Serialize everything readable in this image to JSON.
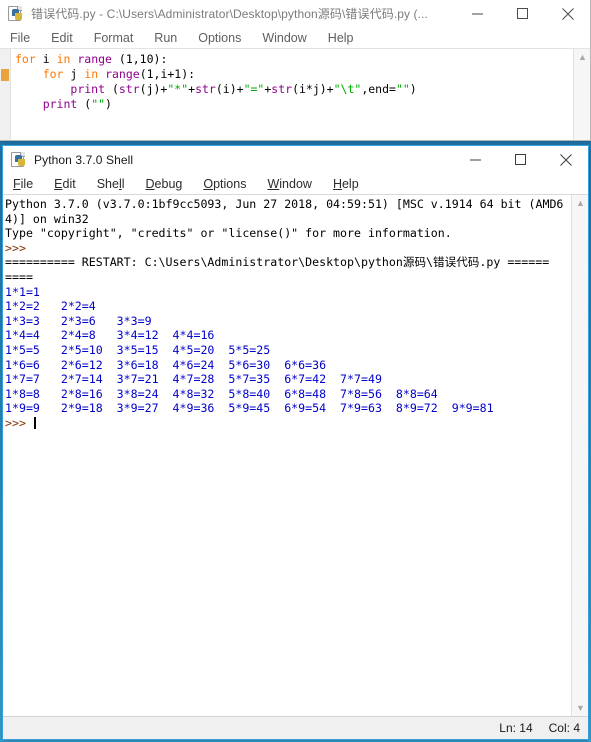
{
  "editor_window": {
    "title": "错误代码.py - C:\\Users\\Administrator\\Desktop\\python源码\\错误代码.py (...",
    "icon": "python-file-icon",
    "controls": {
      "minimize": "minimize-icon",
      "maximize": "maximize-icon",
      "close": "close-icon"
    },
    "menu": [
      "File",
      "Edit",
      "Format",
      "Run",
      "Options",
      "Window",
      "Help"
    ],
    "code_lines": [
      [
        {
          "t": "for",
          "c": "orange"
        },
        {
          "t": " i ",
          "c": "black"
        },
        {
          "t": "in",
          "c": "orange"
        },
        {
          "t": " ",
          "c": "black"
        },
        {
          "t": "range",
          "c": "purple"
        },
        {
          "t": " (1,10):",
          "c": "black"
        }
      ],
      [
        {
          "t": "    ",
          "c": "black"
        },
        {
          "t": "for",
          "c": "orange"
        },
        {
          "t": " j ",
          "c": "black"
        },
        {
          "t": "in",
          "c": "orange"
        },
        {
          "t": " ",
          "c": "black"
        },
        {
          "t": "range",
          "c": "purple"
        },
        {
          "t": "(1,i+1):",
          "c": "black"
        }
      ],
      [
        {
          "t": "        ",
          "c": "black"
        },
        {
          "t": "print",
          "c": "purple"
        },
        {
          "t": " (",
          "c": "black"
        },
        {
          "t": "str",
          "c": "purple"
        },
        {
          "t": "(j)+",
          "c": "black"
        },
        {
          "t": "\"*\"",
          "c": "green"
        },
        {
          "t": "+",
          "c": "black"
        },
        {
          "t": "str",
          "c": "purple"
        },
        {
          "t": "(i)+",
          "c": "black"
        },
        {
          "t": "\"=\"",
          "c": "green"
        },
        {
          "t": "+",
          "c": "black"
        },
        {
          "t": "str",
          "c": "purple"
        },
        {
          "t": "(i*j)+",
          "c": "black"
        },
        {
          "t": "\"\\t\"",
          "c": "green"
        },
        {
          "t": ",end=",
          "c": "black"
        },
        {
          "t": "\"\"",
          "c": "green"
        },
        {
          "t": ")",
          "c": "black"
        }
      ],
      [
        {
          "t": "    ",
          "c": "black"
        },
        {
          "t": "print",
          "c": "purple"
        },
        {
          "t": " (",
          "c": "black"
        },
        {
          "t": "\"\"",
          "c": "green"
        },
        {
          "t": ")",
          "c": "black"
        }
      ]
    ]
  },
  "shell_window": {
    "title": "Python 3.7.0 Shell",
    "icon": "python-shell-icon",
    "controls": {
      "minimize": "minimize-icon",
      "maximize": "maximize-icon",
      "close": "close-icon"
    },
    "menu": [
      {
        "label": "File",
        "accel": "F"
      },
      {
        "label": "Edit",
        "accel": "E"
      },
      {
        "label": "Shell",
        "accel": "l"
      },
      {
        "label": "Debug",
        "accel": "D"
      },
      {
        "label": "Options",
        "accel": "O"
      },
      {
        "label": "Window",
        "accel": "W"
      },
      {
        "label": "Help",
        "accel": "H"
      }
    ],
    "output_lines": [
      {
        "t": "Python 3.7.0 (v3.7.0:1bf9cc5093, Jun 27 2018, 04:59:51) [MSC v.1914 64 bit (AMD6",
        "c": "black"
      },
      {
        "t": "4)] on win32",
        "c": "black"
      },
      {
        "t": "Type \"copyright\", \"credits\" or \"license()\" for more information.",
        "c": "black"
      },
      {
        "t": ">>> ",
        "c": "brown"
      },
      {
        "t": "========== RESTART: C:\\Users\\Administrator\\Desktop\\python源码\\错误代码.py ======",
        "c": "black"
      },
      {
        "t": "====",
        "c": "black"
      },
      {
        "t": "1*1=1",
        "c": "blue"
      },
      {
        "t": "1*2=2   2*2=4",
        "c": "blue"
      },
      {
        "t": "1*3=3   2*3=6   3*3=9",
        "c": "blue"
      },
      {
        "t": "1*4=4   2*4=8   3*4=12  4*4=16",
        "c": "blue"
      },
      {
        "t": "1*5=5   2*5=10  3*5=15  4*5=20  5*5=25",
        "c": "blue"
      },
      {
        "t": "1*6=6   2*6=12  3*6=18  4*6=24  5*6=30  6*6=36",
        "c": "blue"
      },
      {
        "t": "1*7=7   2*7=14  3*7=21  4*7=28  5*7=35  6*7=42  7*7=49",
        "c": "blue"
      },
      {
        "t": "1*8=8   2*8=16  3*8=24  4*8=32  5*8=40  6*8=48  7*8=56  8*8=64",
        "c": "blue"
      },
      {
        "t": "1*9=9   2*9=18  3*9=27  4*9=36  5*9=45  6*9=54  7*9=63  8*9=72  9*9=81",
        "c": "blue"
      }
    ],
    "prompt": ">>> ",
    "status": {
      "line_label": "Ln: 14",
      "col_label": "Col: 4"
    }
  },
  "colors": {
    "keyword": "#ff7700",
    "builtin": "#900090",
    "string": "#00aa00",
    "stdout": "#0000cc",
    "prompt": "#883300",
    "active_border": "#3aa0dc",
    "desktop": "#2b8fc4"
  }
}
